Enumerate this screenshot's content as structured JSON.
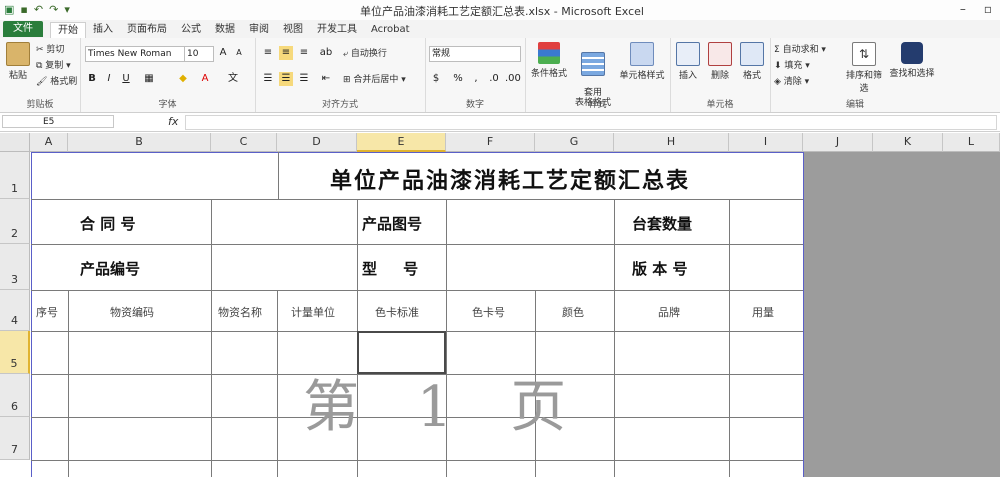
{
  "window": {
    "title": "单位产品油漆消耗工艺定额汇总表.xlsx - Microsoft Excel"
  },
  "ribbon_tabs": {
    "file": "文件",
    "items": [
      "开始",
      "插入",
      "页面布局",
      "公式",
      "数据",
      "审阅",
      "视图",
      "开发工具",
      "Acrobat"
    ],
    "active": "开始"
  },
  "ribbon": {
    "clipboard": {
      "paste": "粘贴",
      "cut": "剪切",
      "copy": "复制 ▾",
      "format_painter": "格式刷",
      "label": "剪贴板"
    },
    "font": {
      "name": "Times New Roman",
      "size": "10",
      "label": "字体"
    },
    "alignment": {
      "wrap": "自动换行",
      "merge": "合并后居中 ▾",
      "label": "对齐方式"
    },
    "number": {
      "format": "常规",
      "label": "数字"
    },
    "styles": {
      "cond": "条件格式",
      "table": "套用\n表格格式",
      "cell": "单元格样式",
      "label": "样式"
    },
    "cells": {
      "insert": "插入",
      "delete": "删除",
      "format": "格式",
      "label": "单元格"
    },
    "editing": {
      "autosum": "自动求和 ▾",
      "fill": "填充 ▾",
      "clear": "清除 ▾",
      "sort": "排序和筛选",
      "find": "查找和选择",
      "label": "编辑"
    }
  },
  "formula_bar": {
    "name_box": "E5",
    "fx": "fx",
    "value": ""
  },
  "columns": [
    "A",
    "B",
    "C",
    "D",
    "E",
    "F",
    "G",
    "H",
    "I",
    "J",
    "K",
    "L"
  ],
  "selected_column": "E",
  "rows": [
    "1",
    "2",
    "3",
    "4",
    "5",
    "6",
    "7"
  ],
  "selected_row": "5",
  "sheet": {
    "title": "单位产品油漆消耗工艺定额汇总表",
    "contract_no": "合 同 号",
    "drawing_no": "产品图号",
    "set_qty": "台套数量",
    "product_code": "产品编号",
    "model": "型     号",
    "version": "版 本 号",
    "headers": [
      "序号",
      "物资编码",
      "物资名称",
      "计量单位",
      "色卡标准",
      "色卡号",
      "颜色",
      "品牌",
      "用量"
    ],
    "watermark": "第 1 页"
  },
  "colors": {
    "accent": "#2a7d3b",
    "page_border": "#5a5fc8",
    "selected_header": "#f7e7a8"
  }
}
